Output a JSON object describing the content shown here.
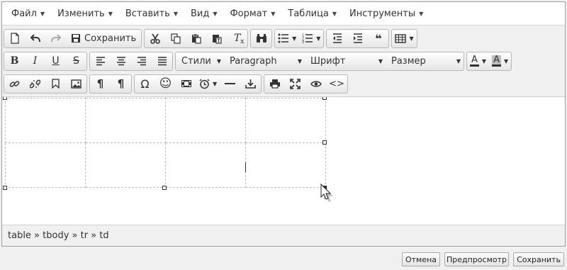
{
  "menubar": [
    {
      "label": "Файл"
    },
    {
      "label": "Изменить"
    },
    {
      "label": "Вставить"
    },
    {
      "label": "Вид"
    },
    {
      "label": "Формат"
    },
    {
      "label": "Таблица"
    },
    {
      "label": "Инструменты"
    }
  ],
  "toolbar": {
    "save_label": "Сохранить",
    "styles_label": "Стили",
    "format_label": "Paragraph",
    "font_label": "Шрифт",
    "size_label": "Размер",
    "text_color_glyph": "A",
    "bg_color_glyph": "A",
    "bold_glyph": "B",
    "italic_glyph": "I",
    "underline_glyph": "U",
    "strike_glyph": "S",
    "clear_format_glyph": "T",
    "quote_glyph": "❝",
    "pilcrow_glyph": "¶",
    "omega_glyph": "Ω",
    "smiley_glyph": "☺",
    "code_glyph": "<>",
    "text_color_hex": "#333333"
  },
  "statusbar": {
    "path": "table » tbody » tr » td"
  },
  "footer": {
    "cancel": "Отмена",
    "preview": "Предпросмотр",
    "save": "Сохранить"
  }
}
